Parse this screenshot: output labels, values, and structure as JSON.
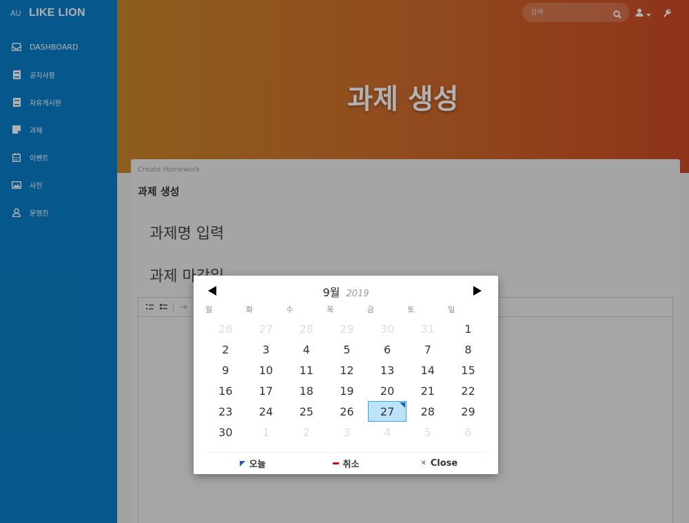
{
  "sidebar": {
    "brand_mini": "AU",
    "brand_name": "LIKE LION",
    "items": [
      {
        "label": "DASHBOARD",
        "icon": "inbox-icon"
      },
      {
        "label": "공지사항",
        "icon": "book-icon"
      },
      {
        "label": "자유게시판",
        "icon": "book-icon"
      },
      {
        "label": "과제",
        "icon": "note-icon"
      },
      {
        "label": "이벤트",
        "icon": "calendar-icon"
      },
      {
        "label": "사진",
        "icon": "image-icon"
      },
      {
        "label": "운영진",
        "icon": "user-icon"
      }
    ]
  },
  "header": {
    "search_placeholder": "검색",
    "title": "과제 생성"
  },
  "card": {
    "subtitle": "Create Homework",
    "title": "과제 생성",
    "field_name_label": "과제명 입력",
    "field_due_label": "과제 마감일"
  },
  "datepicker": {
    "month": "9월",
    "year": "2019",
    "weekdays": [
      "월",
      "화",
      "수",
      "목",
      "금",
      "토",
      "일"
    ],
    "weeks": [
      [
        "26",
        "27",
        "28",
        "29",
        "30",
        "31",
        "1"
      ],
      [
        "2",
        "3",
        "4",
        "5",
        "6",
        "7",
        "8"
      ],
      [
        "9",
        "10",
        "11",
        "12",
        "13",
        "14",
        "15"
      ],
      [
        "16",
        "17",
        "18",
        "19",
        "20",
        "21",
        "22"
      ],
      [
        "23",
        "24",
        "25",
        "26",
        "27",
        "28",
        "29"
      ],
      [
        "30",
        "1",
        "2",
        "3",
        "4",
        "5",
        "6"
      ]
    ],
    "selected_day": "27",
    "footer": {
      "today": "오늘",
      "clear": "취소",
      "close": "Close"
    }
  },
  "colors": {
    "sidebar": "#0a7fc9",
    "header_start": "#c98729",
    "header_end": "#cc4a24",
    "selected_bg": "#bde3fb",
    "selected_border": "#3aa3e6",
    "today_marker": "#1f5fbf",
    "clear_marker": "#cc1111"
  }
}
